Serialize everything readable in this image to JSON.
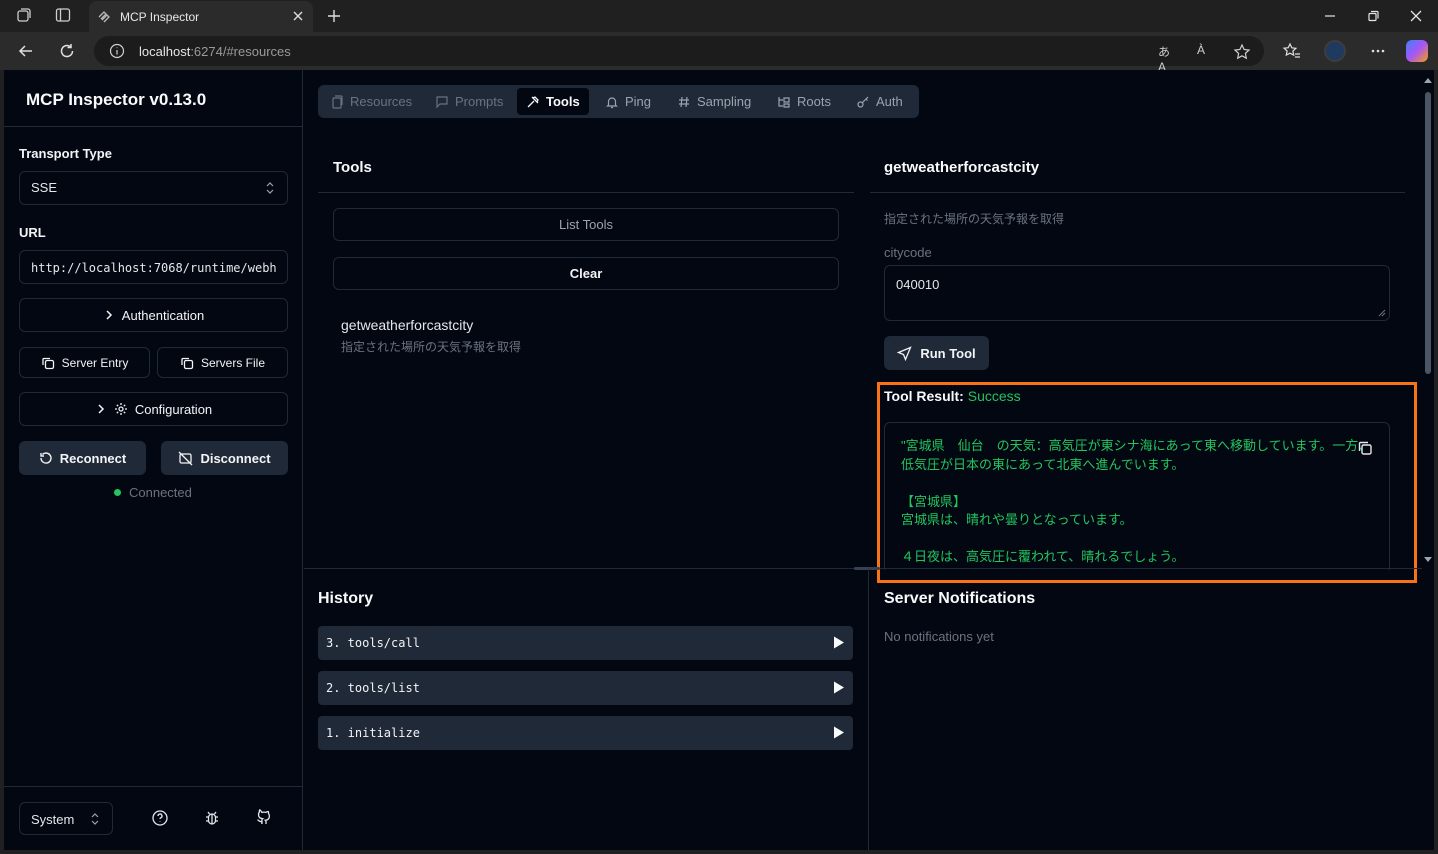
{
  "browser": {
    "tab_title": "MCP Inspector",
    "url_host": "localhost",
    "url_rest": ":6274/#resources",
    "translate_label": "あA",
    "read_aloud_label": "À"
  },
  "sidebar": {
    "title": "MCP Inspector v0.13.0",
    "transport_label": "Transport Type",
    "transport_value": "SSE",
    "url_label": "URL",
    "url_value": "http://localhost:7068/runtime/webh",
    "authentication_label": "Authentication",
    "server_entry_label": "Server Entry",
    "servers_file_label": "Servers File",
    "configuration_label": "Configuration",
    "reconnect_label": "Reconnect",
    "disconnect_label": "Disconnect",
    "status_text": "Connected",
    "status_color": "#22c55e",
    "theme_value": "System"
  },
  "tabs": [
    {
      "label": "Resources",
      "icon": "files-icon"
    },
    {
      "label": "Prompts",
      "icon": "message-icon"
    },
    {
      "label": "Tools",
      "icon": "hammer-icon"
    },
    {
      "label": "Ping",
      "icon": "bell-icon"
    },
    {
      "label": "Sampling",
      "icon": "hash-icon"
    },
    {
      "label": "Roots",
      "icon": "folder-tree-icon"
    },
    {
      "label": "Auth",
      "icon": "key-icon"
    }
  ],
  "tools_panel": {
    "title": "Tools",
    "list_tools_label": "List Tools",
    "clear_label": "Clear",
    "items": [
      {
        "name": "getweatherforcastcity",
        "description": "指定された場所の天気予報を取得"
      }
    ]
  },
  "tool_detail": {
    "title": "getweatherforcastcity",
    "description": "指定された場所の天気予報を取得",
    "param_label": "citycode",
    "param_value": "040010",
    "run_label": "Run Tool",
    "result_label": "Tool Result:",
    "result_status": "Success",
    "result_lines": [
      "\"宮城県　仙台　の天気：高気圧が東シナ海にあって東へ移動しています。一方、",
      "低気圧が日本の東にあって北東へ進んでいます。",
      "",
      "【宮城県】",
      "宮城県は、晴れや曇りとなっています。",
      "",
      "４日夜は、高気圧に覆われて、晴れるでしょう。"
    ],
    "accent_color": "#f97316"
  },
  "history": {
    "title": "History",
    "items": [
      "3. tools/call",
      "2. tools/list",
      "1. initialize"
    ]
  },
  "notifications": {
    "title": "Server Notifications",
    "empty_text": "No notifications yet"
  }
}
